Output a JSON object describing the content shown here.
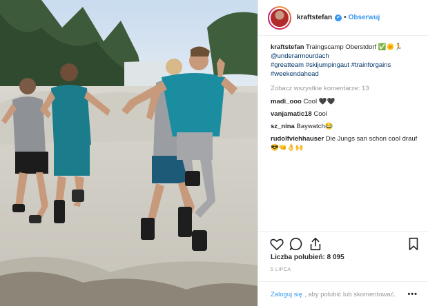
{
  "post": {
    "author": {
      "username": "kraftstefan",
      "verified_badge": "✔",
      "separator": "•",
      "follow_label": "Obserwuj"
    },
    "caption": {
      "username": "kraftstefan",
      "text": "Traingscamp Oberstdorf ✅🌞🏃",
      "mention": "@underarmourdach",
      "hashtags": [
        "#greatteam",
        "#skijumpingaut",
        "#trainforgains",
        "#weekendahead"
      ]
    },
    "view_all_comments": "Zobacz wszystkie komentarze: 13",
    "comments": [
      {
        "username": "madi_ooo",
        "text": "Cool 🖤🖤"
      },
      {
        "username": "vanjamatic18",
        "text": "Cool"
      },
      {
        "username": "sz_nina",
        "text": "Baywatch😂"
      },
      {
        "username": "rudolfviehhauser",
        "text": "Die Jungs san schon cool drauf 😎🤜👌🙌"
      }
    ],
    "actions": {
      "icons": [
        "heart-icon",
        "comment-icon",
        "share-icon",
        "bookmark-icon"
      ]
    },
    "likes_label": "Liczba polubień: 8 095",
    "date": "5 LIPCA",
    "login": {
      "link": "Zaloguj się",
      "text": ", aby polubić lub skomentować."
    },
    "more_label": "•••"
  },
  "colors": {
    "link_blue": "#3897f0",
    "mention_blue": "#003569",
    "muted_gray": "#999999",
    "text": "#262626"
  }
}
